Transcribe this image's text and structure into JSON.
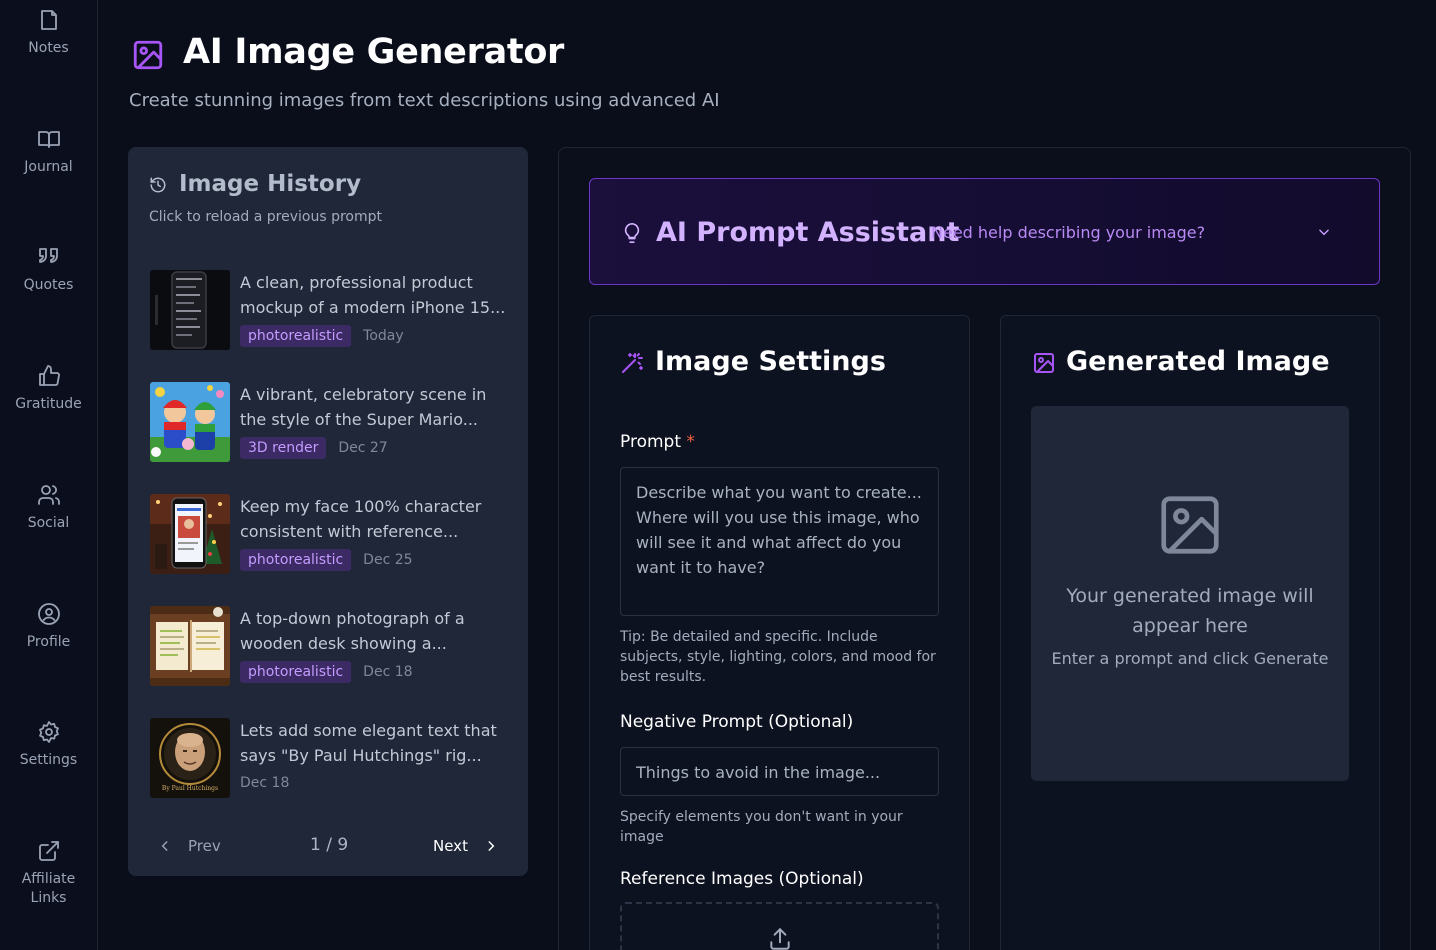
{
  "sidebar": {
    "items": [
      {
        "label": "Notes",
        "icon": "note-icon"
      },
      {
        "label": "Journal",
        "icon": "book-icon"
      },
      {
        "label": "Quotes",
        "icon": "quote-icon"
      },
      {
        "label": "Gratitude",
        "icon": "thumbs-up-icon"
      },
      {
        "label": "Social",
        "icon": "users-icon"
      },
      {
        "label": "Profile",
        "icon": "user-circle-icon"
      },
      {
        "label": "Settings",
        "icon": "gear-icon"
      },
      {
        "label": "Affiliate Links",
        "icon": "external-link-icon"
      }
    ]
  },
  "header": {
    "title": "AI Image Generator",
    "subtitle": "Create stunning images from text descriptions using advanced AI"
  },
  "history": {
    "title": "Image History",
    "subtitle": "Click to reload a previous prompt",
    "items": [
      {
        "text": "A clean, professional product mockup of a modern iPhone 15...",
        "tag": "photorealistic",
        "date": "Today"
      },
      {
        "text": "A vibrant, celebratory scene in the style of the Super Mario...",
        "tag": "3D render",
        "date": "Dec 27"
      },
      {
        "text": "Keep my face 100% character consistent with reference...",
        "tag": "photorealistic",
        "date": "Dec 25"
      },
      {
        "text": "A top-down photograph of a wooden desk showing a...",
        "tag": "photorealistic",
        "date": "Dec 18"
      },
      {
        "text": "Lets add some elegant text that says \"By Paul Hutchings\" rig...",
        "tag": "",
        "date": "Dec 18"
      }
    ],
    "thumb_caption": "By Paul Hutchings",
    "pager": {
      "prev": "Prev",
      "page": "1 / 9",
      "next": "Next"
    }
  },
  "assistant": {
    "title": "AI Prompt Assistant",
    "subtitle": "Need help describing your image?"
  },
  "settings": {
    "title": "Image Settings",
    "prompt_label": "Prompt",
    "required_mark": "*",
    "prompt_placeholder": "Describe what you want to create... Where will you use this image, who will see it and what affect do you want it to have?",
    "prompt_tip": "Tip: Be detailed and specific. Include subjects, style, lighting, colors, and mood for best results.",
    "negative_label": "Negative Prompt (Optional)",
    "negative_placeholder": "Things to avoid in the image...",
    "negative_hint": "Specify elements you don't want in your image",
    "reference_label": "Reference Images (Optional)"
  },
  "generated": {
    "title": "Generated Image",
    "placeholder_title": "Your generated image will appear here",
    "placeholder_sub": "Enter a prompt and click Generate"
  },
  "colors": {
    "accent": "#a855f7",
    "background": "#0a0e1a",
    "panel": "#1f2738",
    "tag_bg": "#3b2a63",
    "tag_text": "#c49bff"
  }
}
